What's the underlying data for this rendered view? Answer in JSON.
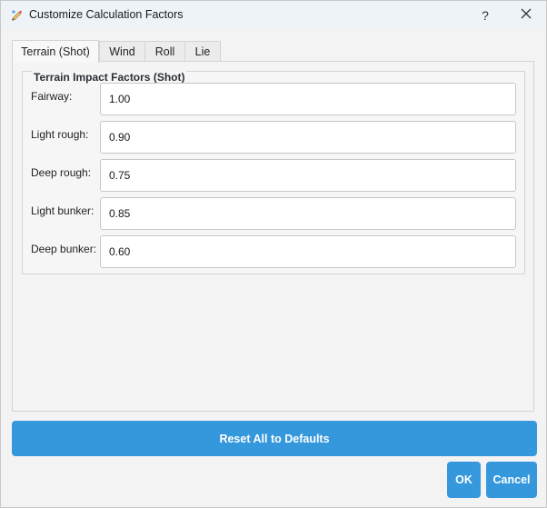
{
  "window": {
    "title": "Customize Calculation Factors",
    "help_label": "?"
  },
  "tabs": [
    {
      "label": "Terrain (Shot)",
      "active": true
    },
    {
      "label": "Wind",
      "active": false
    },
    {
      "label": "Roll",
      "active": false
    },
    {
      "label": "Lie",
      "active": false
    }
  ],
  "group": {
    "title": "Terrain Impact Factors (Shot)",
    "fields": [
      {
        "label": "Fairway:",
        "value": "1.00"
      },
      {
        "label": "Light rough:",
        "value": "0.90"
      },
      {
        "label": "Deep rough:",
        "value": "0.75"
      },
      {
        "label": "Light bunker:",
        "value": "0.85"
      },
      {
        "label": "Deep bunker:",
        "value": "0.60"
      }
    ]
  },
  "buttons": {
    "reset": "Reset All to Defaults",
    "ok": "OK",
    "cancel": "Cancel"
  },
  "colors": {
    "accent": "#3598dc",
    "titlebar": "#eef3f8",
    "background": "#f3f3f3"
  },
  "icons": {
    "app": "paint-brush-icon",
    "close": "close-icon"
  }
}
